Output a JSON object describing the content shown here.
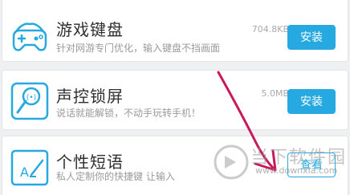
{
  "apps": [
    {
      "name": "游戏键盘",
      "description": "针对网游专门优化，输入键盘不挡画面",
      "size": "704.8KB",
      "button": "安装",
      "icon": "gamepad-icon"
    },
    {
      "name": "声控锁屏",
      "description": "说话就能解锁，不动手玩转手机！",
      "size": "5.0MB",
      "button": "安装",
      "icon": "voice-lock-icon"
    },
    {
      "name": "个性短语",
      "description": "私人定制你的快捷键 让输入",
      "size": "",
      "button": "查看",
      "icon": "phrase-edit-icon"
    }
  ],
  "watermark": {
    "brand": "当下软件园",
    "url": "www.downxia.com"
  },
  "colors": {
    "accent": "#25a9e0",
    "annotation": "#c8195a"
  }
}
